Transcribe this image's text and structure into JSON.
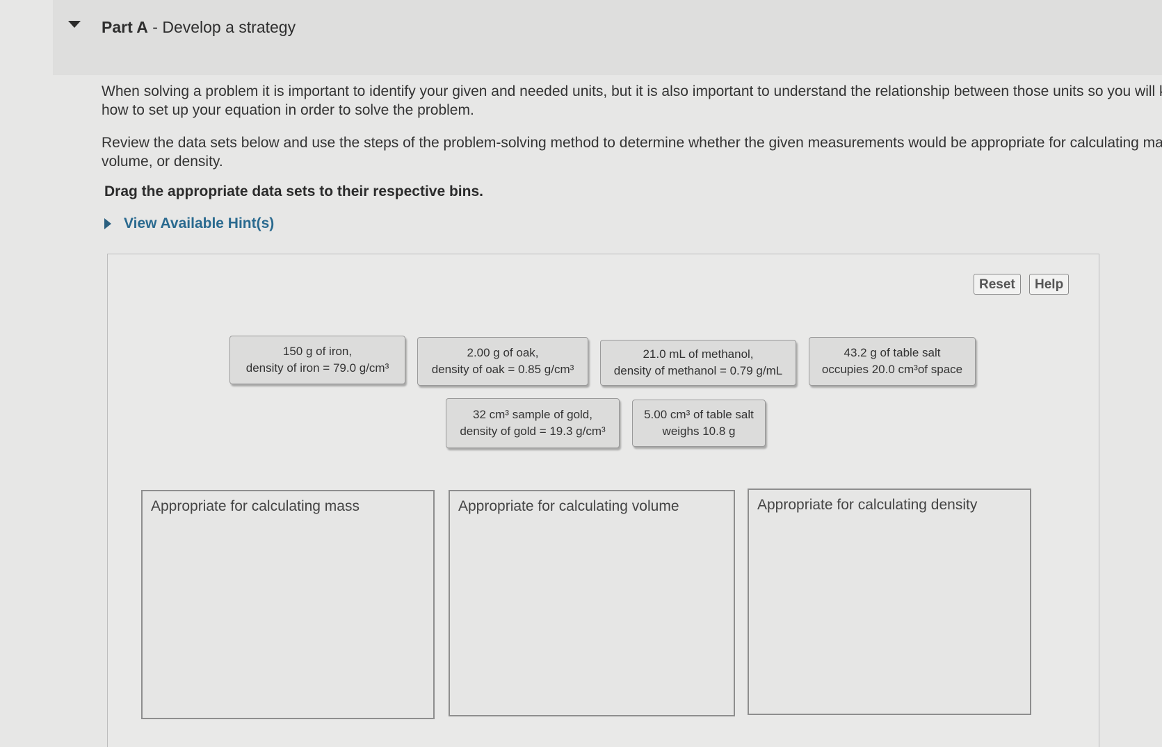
{
  "part": {
    "prefix": "Part A",
    "title": " - Develop a strategy"
  },
  "paragraphs": {
    "p1_line1": "When solving a problem it is important to identify your given and needed units, but it is also important to understand the relationship between those units so you will k",
    "p1_line2": "how to set up your equation in order to solve the problem.",
    "p2_line1": "Review the data sets below and use the steps of the problem-solving method to determine whether the given measurements would be appropriate for calculating mas",
    "p2_line2": "volume, or density."
  },
  "instruction": "Drag the appropriate data sets to their respective bins.",
  "hint_label": "View Available Hint(s)",
  "toolbar": {
    "reset_label": "Reset",
    "help_label": "Help"
  },
  "data_sets": [
    {
      "line1": "150 g of iron,",
      "line2": "density of iron = 79.0 g/cm³"
    },
    {
      "line1": "2.00 g of oak,",
      "line2": "density of oak = 0.85 g/cm³"
    },
    {
      "line1": "21.0 mL of methanol,",
      "line2": "density of methanol = 0.79 g/mL"
    },
    {
      "line1": "43.2 g of table salt",
      "line2": "occupies 20.0 cm³of space"
    },
    {
      "line1": "32 cm³ sample of gold,",
      "line2": "density of gold = 19.3 g/cm³"
    },
    {
      "line1": "5.00 cm³ of table salt",
      "line2": "weighs 10.8 g"
    }
  ],
  "bins": [
    {
      "label": "Appropriate for calculating mass"
    },
    {
      "label": "Appropriate for calculating volume"
    },
    {
      "label": "Appropriate for calculating density"
    }
  ]
}
